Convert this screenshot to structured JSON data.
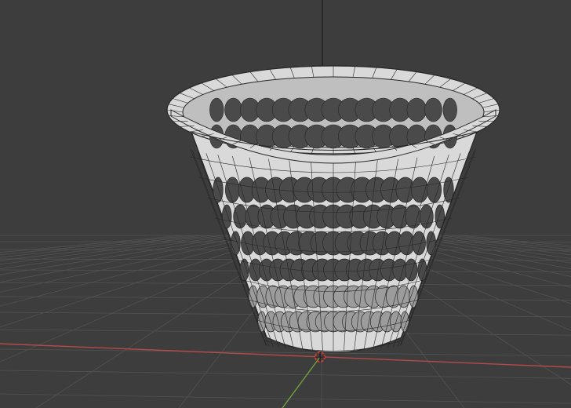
{
  "viewport": {
    "background": "#3d3d3d",
    "grid_color": "#525252",
    "x_axis_color": "#b54a4a",
    "y_axis_color": "#6ea03c",
    "z_axis_color": "#2c2c2c"
  },
  "object": {
    "type": "mesh",
    "semantic": "perforated-wastebasket-mesh",
    "surface_color": "#d9d9d9",
    "inner_color": "#bfbfbf",
    "hole_color": "#4a4a4a",
    "wire_color": "#262626"
  },
  "gizmo": {
    "origin_marker": "3d-cursor-icon"
  }
}
